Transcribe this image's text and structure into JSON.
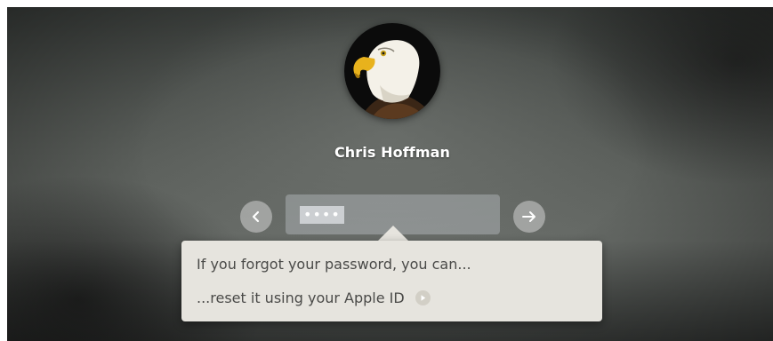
{
  "user": {
    "name": "Chris Hoffman",
    "avatar": "bald-eagle-photo"
  },
  "login": {
    "password_masked": "••••",
    "back_icon": "chevron-left-icon",
    "submit_icon": "arrow-right-icon"
  },
  "hint": {
    "line1": "If you forgot your password, you can...",
    "line2": "...reset it using your Apple ID",
    "line2_icon": "arrow-right-circle-icon"
  },
  "colors": {
    "tooltip_bg": "#e6e4de",
    "tooltip_text": "#4a4a48",
    "name_text": "#ffffff"
  }
}
